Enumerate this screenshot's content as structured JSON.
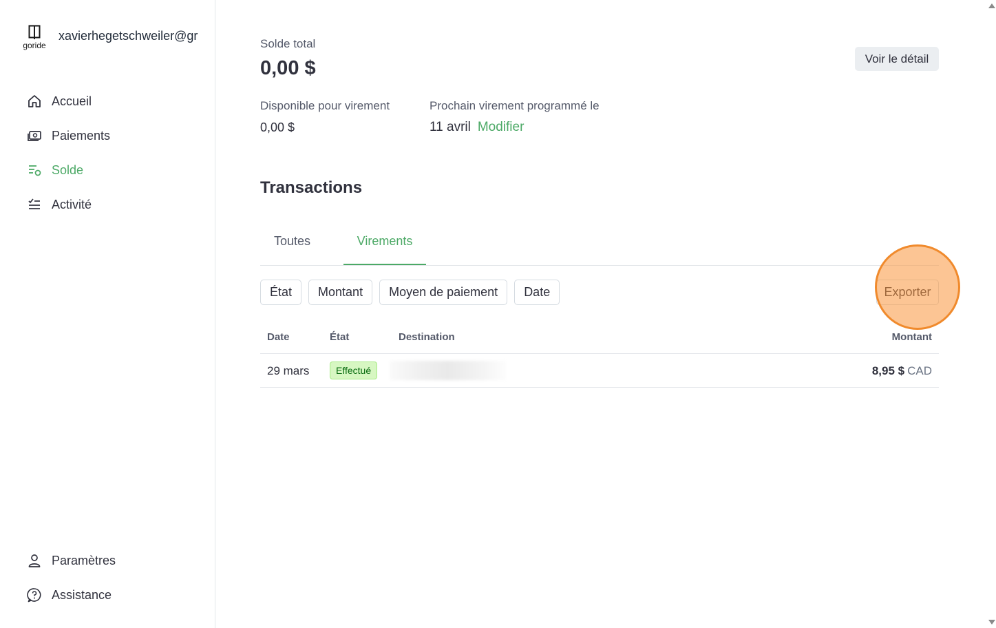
{
  "brand": {
    "logo_text": "goride",
    "account": "xavierhegetschweiler@gr"
  },
  "sidebar": {
    "items": [
      {
        "label": "Accueil",
        "icon": "home-icon",
        "active": false
      },
      {
        "label": "Paiements",
        "icon": "payments-icon",
        "active": false
      },
      {
        "label": "Solde",
        "icon": "balance-icon",
        "active": true
      },
      {
        "label": "Activité",
        "icon": "activity-icon",
        "active": false
      }
    ],
    "bottom_items": [
      {
        "label": "Paramètres",
        "icon": "user-icon"
      },
      {
        "label": "Assistance",
        "icon": "help-icon"
      }
    ]
  },
  "balance": {
    "label": "Solde total",
    "value": "0,00 $",
    "detail_button": "Voir le détail",
    "available_label": "Disponible pour virement",
    "available_value": "0,00 $",
    "next_label": "Prochain virement programmé le",
    "next_date": "11 avril",
    "modify_link": "Modifier"
  },
  "transactions": {
    "title": "Transactions",
    "tabs": [
      "Toutes",
      "Virements"
    ],
    "active_tab": "Virements",
    "filters": [
      "État",
      "Montant",
      "Moyen de paiement",
      "Date"
    ],
    "export_button": "Exporter",
    "columns": [
      "Date",
      "État",
      "Destination",
      "Montant"
    ],
    "rows": [
      {
        "date": "29 mars",
        "status": "Effectué",
        "destination": "",
        "amount": "8,95 $",
        "currency": "CAD"
      }
    ]
  },
  "colors": {
    "accent": "#4ca966",
    "highlight": "#f08a2c",
    "badge_bg": "#d7f7c2",
    "badge_text": "#05690d"
  }
}
